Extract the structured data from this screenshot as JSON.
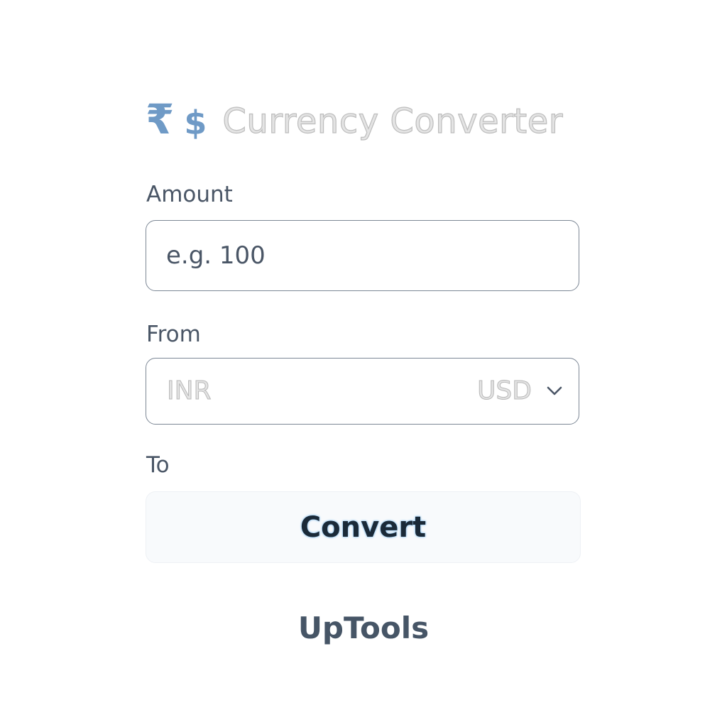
{
  "header": {
    "rupee_symbol": "₹",
    "dollar_symbol": "$",
    "title": "Currency Converter"
  },
  "form": {
    "amount": {
      "label": "Amount",
      "value": "",
      "placeholder": "e.g. 100"
    },
    "from": {
      "label": "From",
      "selected_from": "INR",
      "selected_to": "USD"
    },
    "to": {
      "label": "To"
    },
    "convert_label": "Convert"
  },
  "footer": {
    "brand": "UpTools"
  },
  "icons": {
    "rupee": "rupee-icon",
    "dollar": "dollar-icon",
    "chevron": "chevron-down-icon"
  },
  "colors": {
    "accent_icon": "#6f9ac6",
    "text_primary": "#4a5666",
    "border": "#7c8795",
    "button_bg": "#f8fafc"
  }
}
